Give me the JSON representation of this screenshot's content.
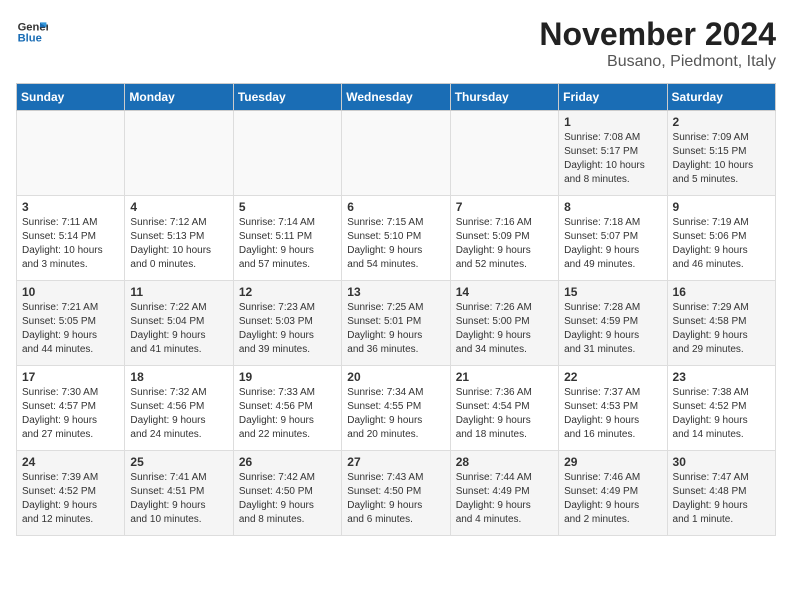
{
  "logo": {
    "line1": "General",
    "line2": "Blue"
  },
  "title": "November 2024",
  "location": "Busano, Piedmont, Italy",
  "weekdays": [
    "Sunday",
    "Monday",
    "Tuesday",
    "Wednesday",
    "Thursday",
    "Friday",
    "Saturday"
  ],
  "weeks": [
    [
      {
        "day": "",
        "info": ""
      },
      {
        "day": "",
        "info": ""
      },
      {
        "day": "",
        "info": ""
      },
      {
        "day": "",
        "info": ""
      },
      {
        "day": "",
        "info": ""
      },
      {
        "day": "1",
        "info": "Sunrise: 7:08 AM\nSunset: 5:17 PM\nDaylight: 10 hours\nand 8 minutes."
      },
      {
        "day": "2",
        "info": "Sunrise: 7:09 AM\nSunset: 5:15 PM\nDaylight: 10 hours\nand 5 minutes."
      }
    ],
    [
      {
        "day": "3",
        "info": "Sunrise: 7:11 AM\nSunset: 5:14 PM\nDaylight: 10 hours\nand 3 minutes."
      },
      {
        "day": "4",
        "info": "Sunrise: 7:12 AM\nSunset: 5:13 PM\nDaylight: 10 hours\nand 0 minutes."
      },
      {
        "day": "5",
        "info": "Sunrise: 7:14 AM\nSunset: 5:11 PM\nDaylight: 9 hours\nand 57 minutes."
      },
      {
        "day": "6",
        "info": "Sunrise: 7:15 AM\nSunset: 5:10 PM\nDaylight: 9 hours\nand 54 minutes."
      },
      {
        "day": "7",
        "info": "Sunrise: 7:16 AM\nSunset: 5:09 PM\nDaylight: 9 hours\nand 52 minutes."
      },
      {
        "day": "8",
        "info": "Sunrise: 7:18 AM\nSunset: 5:07 PM\nDaylight: 9 hours\nand 49 minutes."
      },
      {
        "day": "9",
        "info": "Sunrise: 7:19 AM\nSunset: 5:06 PM\nDaylight: 9 hours\nand 46 minutes."
      }
    ],
    [
      {
        "day": "10",
        "info": "Sunrise: 7:21 AM\nSunset: 5:05 PM\nDaylight: 9 hours\nand 44 minutes."
      },
      {
        "day": "11",
        "info": "Sunrise: 7:22 AM\nSunset: 5:04 PM\nDaylight: 9 hours\nand 41 minutes."
      },
      {
        "day": "12",
        "info": "Sunrise: 7:23 AM\nSunset: 5:03 PM\nDaylight: 9 hours\nand 39 minutes."
      },
      {
        "day": "13",
        "info": "Sunrise: 7:25 AM\nSunset: 5:01 PM\nDaylight: 9 hours\nand 36 minutes."
      },
      {
        "day": "14",
        "info": "Sunrise: 7:26 AM\nSunset: 5:00 PM\nDaylight: 9 hours\nand 34 minutes."
      },
      {
        "day": "15",
        "info": "Sunrise: 7:28 AM\nSunset: 4:59 PM\nDaylight: 9 hours\nand 31 minutes."
      },
      {
        "day": "16",
        "info": "Sunrise: 7:29 AM\nSunset: 4:58 PM\nDaylight: 9 hours\nand 29 minutes."
      }
    ],
    [
      {
        "day": "17",
        "info": "Sunrise: 7:30 AM\nSunset: 4:57 PM\nDaylight: 9 hours\nand 27 minutes."
      },
      {
        "day": "18",
        "info": "Sunrise: 7:32 AM\nSunset: 4:56 PM\nDaylight: 9 hours\nand 24 minutes."
      },
      {
        "day": "19",
        "info": "Sunrise: 7:33 AM\nSunset: 4:56 PM\nDaylight: 9 hours\nand 22 minutes."
      },
      {
        "day": "20",
        "info": "Sunrise: 7:34 AM\nSunset: 4:55 PM\nDaylight: 9 hours\nand 20 minutes."
      },
      {
        "day": "21",
        "info": "Sunrise: 7:36 AM\nSunset: 4:54 PM\nDaylight: 9 hours\nand 18 minutes."
      },
      {
        "day": "22",
        "info": "Sunrise: 7:37 AM\nSunset: 4:53 PM\nDaylight: 9 hours\nand 16 minutes."
      },
      {
        "day": "23",
        "info": "Sunrise: 7:38 AM\nSunset: 4:52 PM\nDaylight: 9 hours\nand 14 minutes."
      }
    ],
    [
      {
        "day": "24",
        "info": "Sunrise: 7:39 AM\nSunset: 4:52 PM\nDaylight: 9 hours\nand 12 minutes."
      },
      {
        "day": "25",
        "info": "Sunrise: 7:41 AM\nSunset: 4:51 PM\nDaylight: 9 hours\nand 10 minutes."
      },
      {
        "day": "26",
        "info": "Sunrise: 7:42 AM\nSunset: 4:50 PM\nDaylight: 9 hours\nand 8 minutes."
      },
      {
        "day": "27",
        "info": "Sunrise: 7:43 AM\nSunset: 4:50 PM\nDaylight: 9 hours\nand 6 minutes."
      },
      {
        "day": "28",
        "info": "Sunrise: 7:44 AM\nSunset: 4:49 PM\nDaylight: 9 hours\nand 4 minutes."
      },
      {
        "day": "29",
        "info": "Sunrise: 7:46 AM\nSunset: 4:49 PM\nDaylight: 9 hours\nand 2 minutes."
      },
      {
        "day": "30",
        "info": "Sunrise: 7:47 AM\nSunset: 4:48 PM\nDaylight: 9 hours\nand 1 minute."
      }
    ]
  ]
}
